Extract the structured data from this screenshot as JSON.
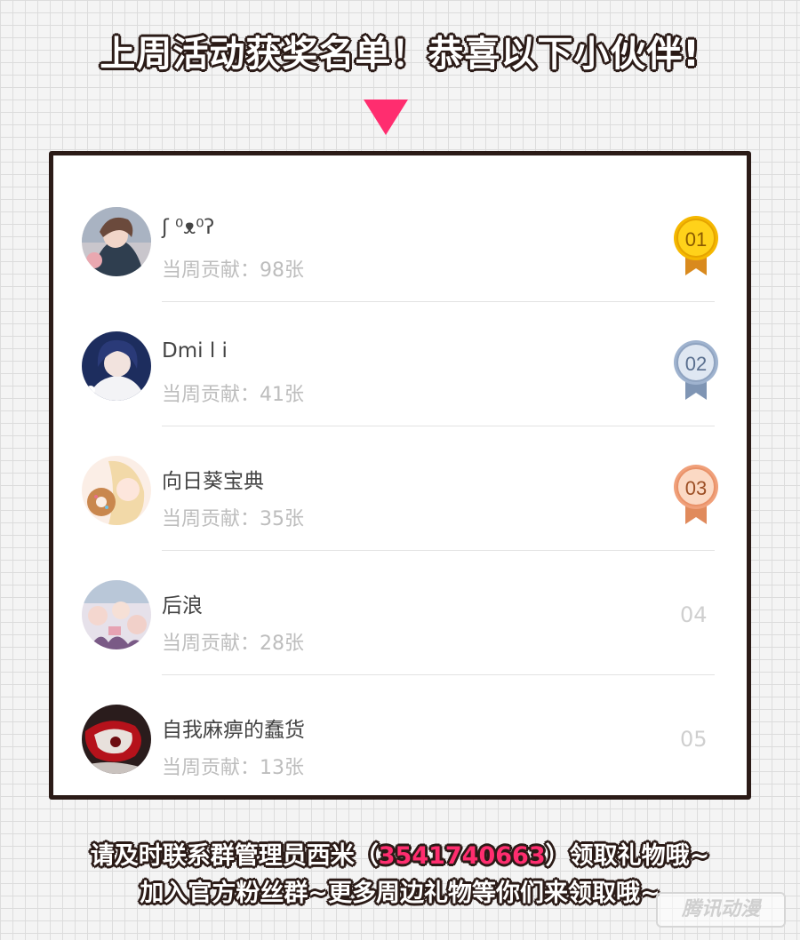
{
  "header": {
    "title": "上周活动获奖名单！恭喜以下小伙伴!"
  },
  "winners": [
    {
      "name": "ʃ  ⁰ᴥ⁰ʔ",
      "contribution": "当周贡献：98张",
      "rank": "01",
      "medal": "gold"
    },
    {
      "name": "Dmi l i",
      "contribution": "当周贡献：41张",
      "rank": "02",
      "medal": "silver"
    },
    {
      "name": "向日葵宝典",
      "contribution": "当周贡献：35张",
      "rank": "03",
      "medal": "bronze"
    },
    {
      "name": "后浪",
      "contribution": "当周贡献：28张",
      "rank": "04",
      "medal": "none"
    },
    {
      "name": "自我麻痹的蠢货",
      "contribution": "当周贡献：13张",
      "rank": "05",
      "medal": "none"
    }
  ],
  "footer": {
    "line1_pre": "请及时联系群管理员西米（",
    "phone": "3541740663",
    "line1_post": "）领取礼物哦~",
    "line2": "加入官方粉丝群~更多周边礼物等你们来领取哦~"
  },
  "watermark": "腾讯动漫",
  "colors": {
    "accent": "#ff2d6f",
    "gold": "#f5b800",
    "silver": "#9fb3cf",
    "bronze": "#f0a07a",
    "outline": "#2b1b17"
  }
}
